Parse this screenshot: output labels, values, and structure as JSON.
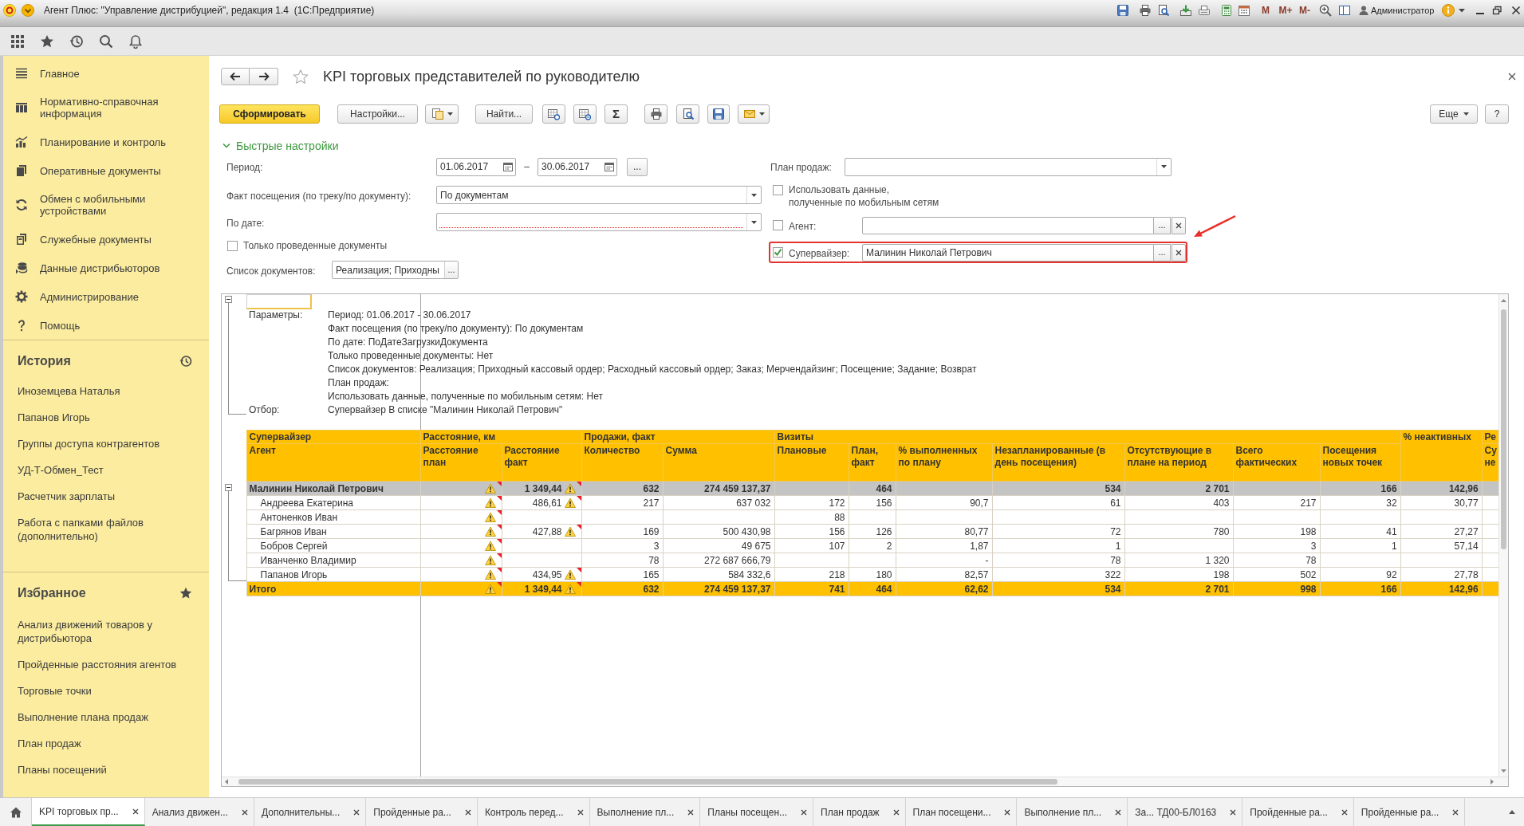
{
  "window": {
    "title": "Агент Плюс: \"Управление дистрибуцией\", редакция 1.4  (1С:Предприятие)",
    "memory_buttons": [
      "M",
      "M+",
      "M-"
    ],
    "user": "Администратор"
  },
  "sidebar": {
    "sections": [
      "Главное",
      "Нормативно-справочная информация",
      "Планирование и контроль",
      "Оперативные документы",
      "Обмен с мобильными устройствами",
      "Служебные документы",
      "Данные дистрибьюторов",
      "Администрирование",
      "Помощь"
    ],
    "history": {
      "title": "История",
      "items": [
        "Иноземцева Наталья",
        "Папанов Игорь",
        "Группы доступа контрагентов",
        "УД-Т-Обмен_Тест",
        "Расчетчик зарплаты",
        "Работа с папками файлов (дополнительно)"
      ]
    },
    "favorites": {
      "title": "Избранное",
      "items": [
        "Анализ движений товаров у дистрибьютора",
        "Пройденные расстояния агентов",
        "Торговые точки",
        "Выполнение плана продаж",
        "План продаж",
        "Планы посещений"
      ]
    }
  },
  "form": {
    "title": "KPI торговых представителей по руководителю",
    "favorite": false,
    "toolbar": {
      "generate": "Сформировать",
      "settings": "Настройки...",
      "find": "Найти...",
      "sum": "Σ",
      "more": "Еще",
      "help": "?"
    },
    "quick_settings": {
      "title": "Быстрые настройки",
      "expanded": true,
      "period": {
        "label": "Период:",
        "from": "01.06.2017",
        "separator": "–",
        "to": "30.06.2017",
        "button": "..."
      },
      "visit_fact": {
        "label": "Факт посещения (по треку/по документу):",
        "value": "По документам"
      },
      "by_date": {
        "label": "По дате:",
        "required": true
      },
      "posted_only": {
        "label": "Только проведенные документы",
        "checked": false
      },
      "documents": {
        "label": "Список документов:",
        "value": "Реализация; Приходны",
        "button": "..."
      },
      "sales_plan": {
        "label": "План продаж:"
      },
      "use_mobile": {
        "label": "Использовать данные,\nполученные по мобильным сетям",
        "checked": false
      },
      "filters": [
        {
          "label": "Агент:",
          "checked": false,
          "highlighted": false,
          "select_button": "..."
        },
        {
          "label": "Супервайзер:",
          "checked": true,
          "value": "Малинин Николай Петрович",
          "highlighted": true,
          "select_button": "..."
        }
      ]
    }
  },
  "report": {
    "parameters": {
      "expanded": true,
      "label": "Параметры:",
      "lines": [
        "Период: 01.06.2017 - 30.06.2017",
        "Факт посещения (по треку/по документу): По документам",
        "По дате: ПоДатеЗагрузкиДокумента",
        "Только проведенные документы: Нет",
        "Список документов: Реализация; Приходный кассовый ордер; Расходный кассовый ордер; Заказ; Мерчендайзинг; Посещение; Задание; Возврат",
        "План продаж:",
        "Использовать данные, полученные по мобильным сетям: Нет"
      ],
      "filter_label": "Отбор:",
      "filter": "Супервайзер В списке \"Малинин Николай Петрович\""
    },
    "column_groups": [
      {
        "label": "Супервайзер",
        "columns": [
          "Агент"
        ]
      },
      {
        "label": "Расстояние, км",
        "columns": [
          "Расстояние план",
          "Расстояние факт"
        ]
      },
      {
        "label": "Продажи, факт",
        "columns": [
          "Количество",
          "Сумма"
        ]
      },
      {
        "label": "Визиты",
        "columns": [
          "Плановые",
          "План, факт",
          "% выполненных по плану",
          "Незапланированные (в день посещения)",
          "Отсутствующие в плане на период",
          "Всего фактических",
          "Посещения новых точек"
        ]
      },
      {
        "label": "% неактивных"
      },
      {
        "label": "Ре",
        "columns": [
          "Су\nне"
        ]
      }
    ],
    "rows": [
      {
        "kind": "group",
        "name": "Малинин Николай Петрович",
        "expanded": true,
        "distance_plan": {
          "warning": true,
          "note": true
        },
        "distance_fact": {
          "value": "1 349,44",
          "warning": true,
          "note": true
        },
        "values": {
          "quantity": "632",
          "sum": "274 459 137,37",
          "plan_fact": "464",
          "unplanned": "534",
          "absent": "2 701",
          "new_points": "166",
          "percent_inactive": "142,96"
        },
        "children": [
          {
            "kind": "item",
            "name": "Андреева Екатерина",
            "distance_plan": {
              "warning": true,
              "note": true
            },
            "distance_fact": {
              "value": "486,61",
              "warning": true,
              "note": true
            },
            "values": {
              "quantity": "217",
              "sum": "637 032",
              "planned": "172",
              "plan_fact": "156",
              "percent_done": "90,7",
              "unplanned": "61",
              "absent": "403",
              "total_actual": "217",
              "new_points": "32",
              "percent_inactive": "30,77"
            }
          },
          {
            "kind": "item",
            "name": "Антоненков Иван",
            "distance_plan": {
              "warning": true,
              "note": true
            },
            "values": {
              "planned": "88"
            }
          },
          {
            "kind": "item",
            "name": "Багрянов Иван",
            "distance_plan": {
              "warning": true,
              "note": true
            },
            "distance_fact": {
              "value": "427,88",
              "warning": true,
              "note": true
            },
            "values": {
              "quantity": "169",
              "sum": "500 430,98",
              "planned": "156",
              "plan_fact": "126",
              "percent_done": "80,77",
              "unplanned": "72",
              "absent": "780",
              "total_actual": "198",
              "new_points": "41",
              "percent_inactive": "27,27"
            }
          },
          {
            "kind": "item",
            "name": "Бобров Сергей",
            "distance_plan": {
              "warning": true,
              "note": true
            },
            "values": {
              "quantity": "3",
              "sum": "49 675",
              "planned": "107",
              "plan_fact": "2",
              "percent_done": "1,87",
              "unplanned": "1",
              "total_actual": "3",
              "new_points": "1",
              "percent_inactive": "57,14"
            }
          },
          {
            "kind": "item",
            "name": "Иванченко Владимир",
            "distance_plan": {
              "warning": true,
              "note": true
            },
            "values": {
              "quantity": "78",
              "sum": "272 687 666,79",
              "percent_done": "-",
              "unplanned": "78",
              "absent": "1 320",
              "total_actual": "78"
            }
          },
          {
            "kind": "item",
            "name": "Папанов Игорь",
            "distance_plan": {
              "warning": true,
              "note": true
            },
            "distance_fact": {
              "value": "434,95",
              "warning": true,
              "note": true
            },
            "values": {
              "quantity": "165",
              "sum": "584 332,6",
              "planned": "218",
              "plan_fact": "180",
              "percent_done": "82,57",
              "unplanned": "322",
              "absent": "198",
              "total_actual": "502",
              "new_points": "92",
              "percent_inactive": "27,78"
            }
          }
        ]
      },
      {
        "kind": "total",
        "name": "Итого",
        "distance_plan": {
          "warning": true,
          "note": true
        },
        "distance_fact": {
          "value": "1 349,44",
          "warning": true,
          "note": true
        },
        "values": {
          "quantity": "632",
          "sum": "274 459 137,37",
          "planned": "741",
          "plan_fact": "464",
          "percent_done": "62,62",
          "unplanned": "534",
          "absent": "2 701",
          "total_actual": "998",
          "new_points": "166",
          "percent_inactive": "142,96"
        }
      }
    ]
  },
  "tabs": [
    {
      "label": "KPI торговых пр...",
      "selected": true
    },
    {
      "label": "Анализ движен...",
      "selected": false
    },
    {
      "label": "Дополнительны...",
      "selected": false
    },
    {
      "label": "Пройденные ра...",
      "selected": false
    },
    {
      "label": "Контроль перед...",
      "selected": false
    },
    {
      "label": "Выполнение пл...",
      "selected": false
    },
    {
      "label": "Планы посещен...",
      "selected": false
    },
    {
      "label": "План продаж",
      "selected": false
    },
    {
      "label": "План посещени...",
      "selected": false
    },
    {
      "label": "Выполнение пл...",
      "selected": false
    },
    {
      "label": "За... ТД00-БЛ0163",
      "selected": false
    },
    {
      "label": "Пройденные ра...",
      "selected": false
    },
    {
      "label": "Пройденные ра...",
      "selected": false
    }
  ]
}
